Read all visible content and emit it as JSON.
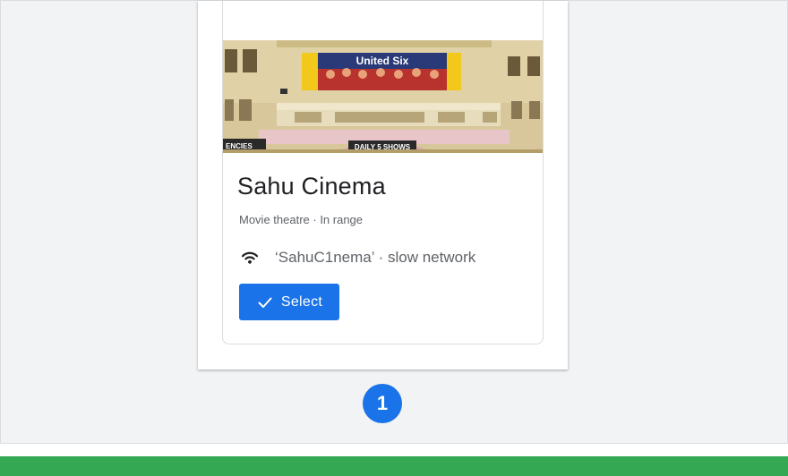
{
  "place": {
    "name": "Sahu Cinema",
    "subtitle": "Movie theatre · In range",
    "photo": {
      "banner_text": "United Six",
      "sign_left": "ENCIES",
      "sign_center": "DAILY 5 SHOWS"
    }
  },
  "network": {
    "icon": "wifi-icon",
    "text": "‘SahuC1nema’ · slow network"
  },
  "action": {
    "icon": "check-icon",
    "label": "Select"
  },
  "step": {
    "number": "1"
  },
  "colors": {
    "accent": "#1a73e8",
    "footer": "#34a853",
    "background": "#f1f3f4"
  }
}
